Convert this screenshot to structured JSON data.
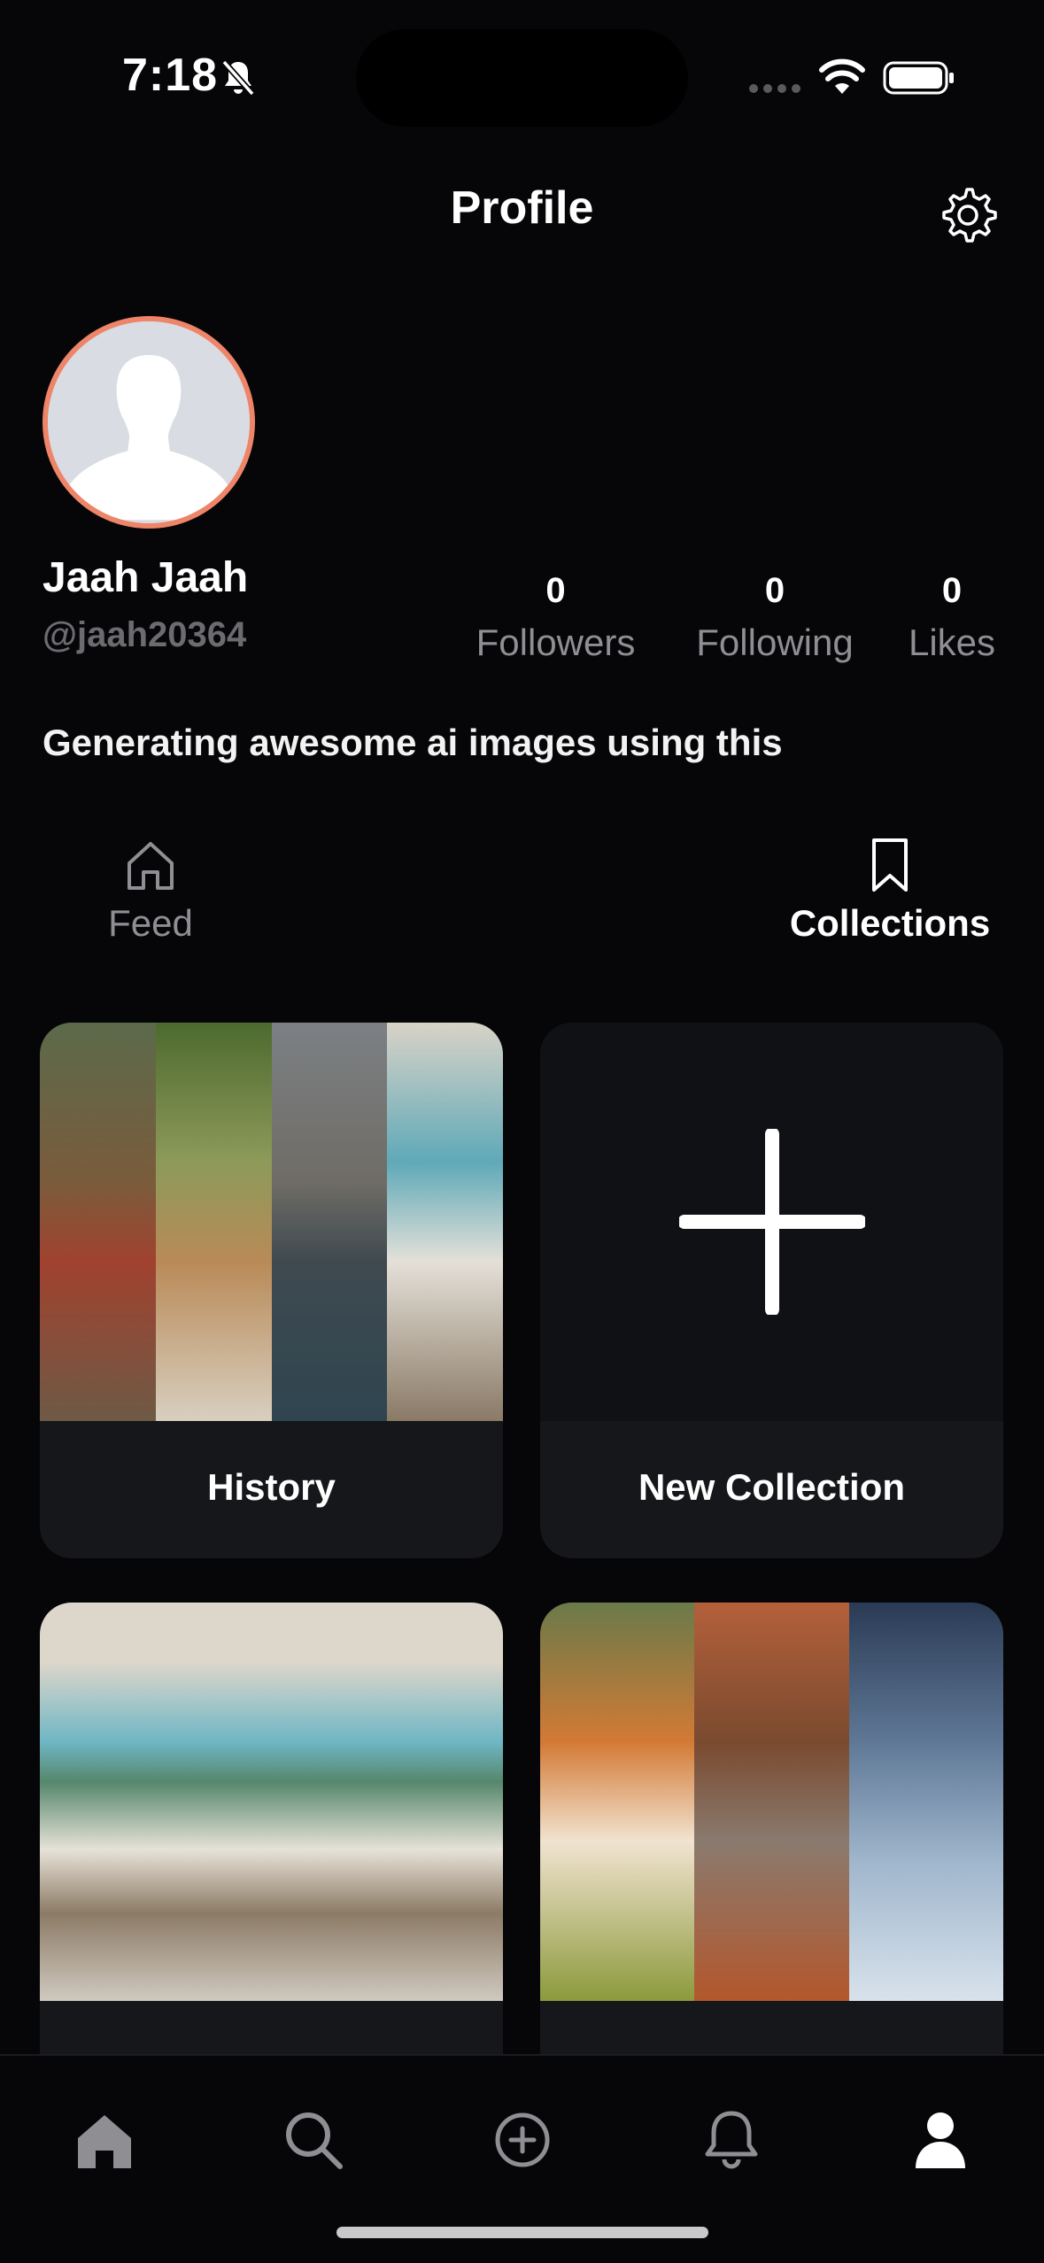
{
  "status_bar": {
    "time": "7:18"
  },
  "header": {
    "title": "Profile"
  },
  "profile": {
    "name": "Jaah Jaah",
    "handle": "@jaah20364",
    "bio": "Generating awesome ai images using this",
    "stats": {
      "followers": {
        "count": "0",
        "label": "Followers"
      },
      "following": {
        "count": "0",
        "label": "Following"
      },
      "likes": {
        "count": "0",
        "label": "Likes"
      }
    }
  },
  "tabs": [
    {
      "label": "Feed",
      "icon": "home-outline-icon",
      "active": false
    },
    {
      "label": "Collections",
      "icon": "bookmark-icon",
      "active": true
    }
  ],
  "collections": [
    {
      "label": "History"
    },
    {
      "label": "New Collection",
      "icon": "plus-icon"
    }
  ],
  "bottom_nav": [
    "home-icon",
    "search-icon",
    "create-icon",
    "notifications-icon",
    "profile-icon"
  ],
  "colors": {
    "background": "#060608",
    "card": "#16171b",
    "avatar_ring": "#ee8468",
    "muted_text": "#8e8e93"
  }
}
